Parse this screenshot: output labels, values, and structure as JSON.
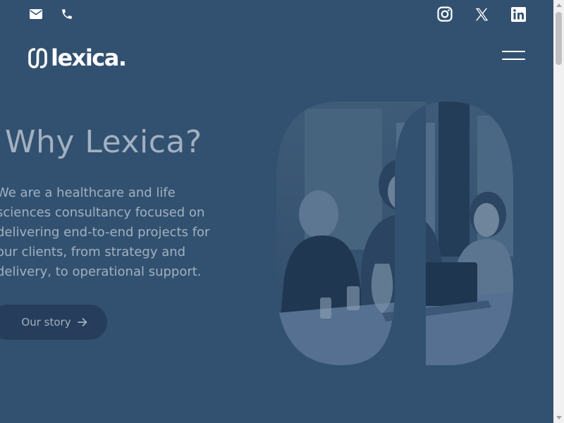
{
  "contact": {
    "email_icon": "mail-icon",
    "phone_icon": "phone-icon"
  },
  "social": {
    "instagram_icon": "instagram-icon",
    "x_icon": "x-icon",
    "linkedin_icon": "linkedin-icon"
  },
  "brand": {
    "name": "lexica."
  },
  "nav": {
    "menu_icon": "hamburger-menu-icon"
  },
  "hero": {
    "title": "Why Lexica?",
    "body": "We are a healthcare and life\nsciences consultancy focused on\ndelivering end-to-end projects for\nour clients, from strategy and\ndelivery, to operational support.",
    "cta_label": "Our story",
    "cta_icon": "arrow-right-icon"
  },
  "colors": {
    "background": "#325170",
    "muted_text": "#a2b0c0",
    "button": "#263e5c",
    "white": "#ffffff"
  }
}
